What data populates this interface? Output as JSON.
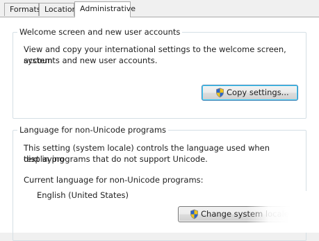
{
  "tabs": [
    {
      "label": "Formats"
    },
    {
      "label": "Location"
    },
    {
      "label": "Administrative"
    }
  ],
  "welcome_group": {
    "title": "Welcome screen and new user accounts",
    "description_line1": "View and copy your international settings to the welcome screen, system",
    "description_line2": "accounts and new user accounts.",
    "copy_button_label": "Copy settings..."
  },
  "language_group": {
    "title": "Language for non-Unicode programs",
    "description_line1": "This setting (system locale) controls the language used when displaying",
    "description_line2": "text in programs that do not support Unicode.",
    "current_label": "Current language for non-Unicode programs:",
    "current_value": "English (United States)",
    "change_button_label": "Change system locale..."
  },
  "colors": {
    "panel_background": "#ffffff",
    "window_background": "#f0f0f0",
    "group_border": "#d5dfe5",
    "default_button_border": "#3c7fb1"
  },
  "icons": {
    "copy_button_icon": "uac-shield-icon",
    "change_button_icon": "uac-shield-icon"
  }
}
